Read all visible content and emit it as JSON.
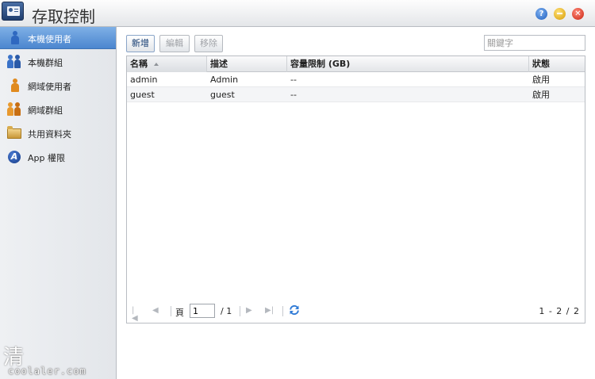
{
  "window": {
    "title": "存取控制",
    "help_label": "?",
    "close_label": "✕"
  },
  "sidebar": {
    "items": [
      {
        "label": "本機使用者",
        "icon": "local-user-icon",
        "active": true
      },
      {
        "label": "本機群組",
        "icon": "local-group-icon",
        "active": false
      },
      {
        "label": "網域使用者",
        "icon": "domain-user-icon",
        "active": false
      },
      {
        "label": "網域群組",
        "icon": "domain-group-icon",
        "active": false
      },
      {
        "label": "共用資料夾",
        "icon": "shared-folder-icon",
        "active": false
      },
      {
        "label": "App 權限",
        "icon": "app-permission-icon",
        "icon_glyph": "A",
        "active": false
      }
    ]
  },
  "toolbar": {
    "add_label": "新增",
    "edit_label": "編輯",
    "remove_label": "移除",
    "search_placeholder": "關鍵字"
  },
  "table": {
    "columns": [
      "名稱",
      "描述",
      "容量限制 (GB)",
      "狀態"
    ],
    "rows": [
      [
        "admin",
        "Admin",
        "--",
        "啟用"
      ],
      [
        "guest",
        "guest",
        "--",
        "啟用"
      ]
    ]
  },
  "pager": {
    "page_label": "頁",
    "current_page": "1",
    "total_pages": "/ 1",
    "range": "1 - 2 / 2"
  },
  "watermark": {
    "glyph": "清",
    "text": "coolaler.com"
  },
  "colors": {
    "active_item": "#4b86cf",
    "add_button_text": "#10386e"
  }
}
